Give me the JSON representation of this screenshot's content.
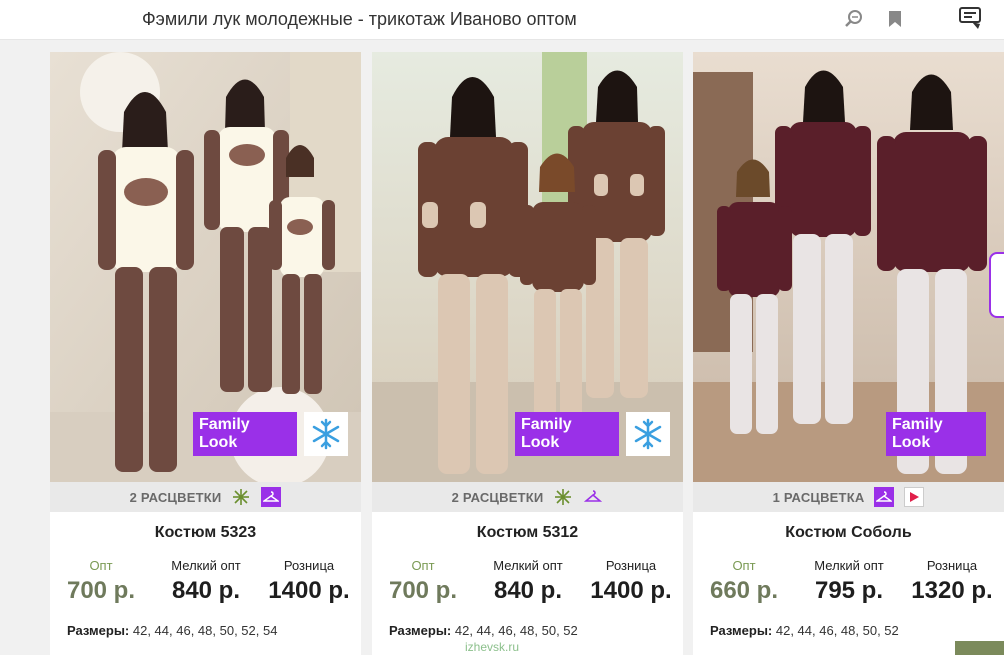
{
  "header": {
    "title": "Фэмили лук молодежные - трикотаж Иваново оптом",
    "icons": [
      "search-icon",
      "bookmark-icon",
      "reader-mode-icon"
    ]
  },
  "price_labels": {
    "opt": "Опт",
    "small_opt": "Мелкий опт",
    "retail": "Розница"
  },
  "sizes_label": "Размеры:",
  "badge_label": "Family Look",
  "products": [
    {
      "name": "Костюм 5323",
      "colors_text": "2 РАСЦВЕТКИ",
      "opt": "700 р.",
      "small_opt": "840 р.",
      "retail": "1400 р.",
      "sizes": "42, 44, 46, 48, 50, 52, 54",
      "winter": true,
      "video": false
    },
    {
      "name": "Костюм 5312",
      "colors_text": "2 РАСЦВЕТКИ",
      "opt": "700 р.",
      "small_opt": "840 р.",
      "retail": "1400 р.",
      "sizes": "42, 44, 46, 48, 50, 52",
      "winter": true,
      "video": false
    },
    {
      "name": "Костюм Соболь",
      "colors_text": "1 РАСЦВЕТКА",
      "opt": "660 р.",
      "small_opt": "795 р.",
      "retail": "1320 р.",
      "sizes": "42, 44, 46, 48, 50, 52",
      "winter": false,
      "video": true
    }
  ],
  "watermark": "izhevsk.ru",
  "colors": {
    "badge": "#9a30e8",
    "opt_price": "#6f7a5c",
    "opt_label": "#7a9a54",
    "strip": "#e9e9e9"
  }
}
